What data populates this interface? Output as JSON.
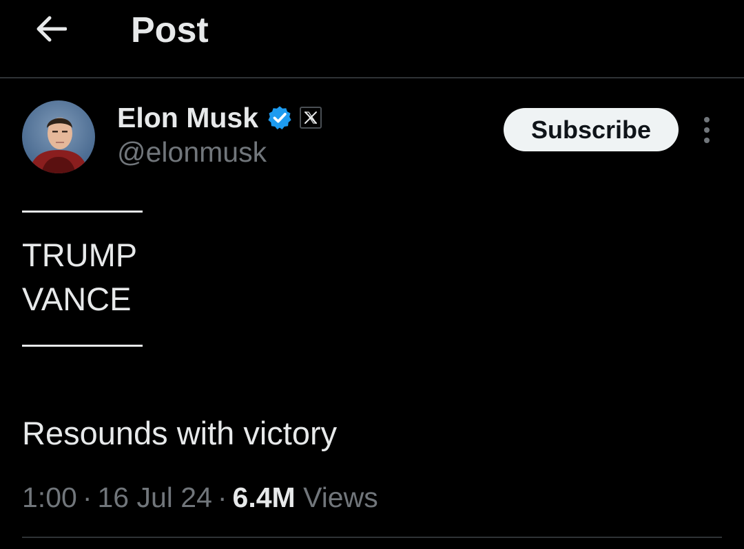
{
  "header": {
    "back_icon": "arrow-left-icon",
    "title": "Post"
  },
  "author": {
    "name": "Elon Musk",
    "handle": "@elonmusk",
    "verified_icon": "verified-badge-icon",
    "affiliate_icon": "x-logo-icon",
    "verified_color": "#1d9bf0"
  },
  "actions": {
    "subscribe_label": "Subscribe",
    "more_icon": "more-vertical-icon"
  },
  "post": {
    "line1": "TRUMP",
    "line2": "VANCE",
    "line3": "Resounds with victory"
  },
  "meta": {
    "time": "1:00",
    "separator": "·",
    "date": "16 Jul 24",
    "views_count": "6.4M",
    "views_label": "Views"
  }
}
